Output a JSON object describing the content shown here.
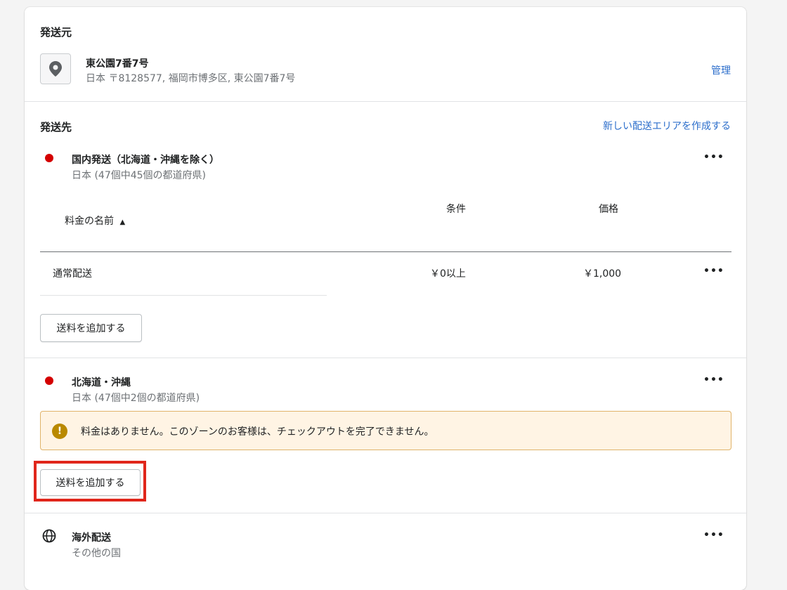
{
  "origin": {
    "title": "発送元",
    "name": "東公園7番7号",
    "address": "日本 〒8128577, 福岡市博多区, 東公園7番7号",
    "manage_link": "管理"
  },
  "destination": {
    "title": "発送先",
    "create_link": "新しい配送エリアを作成する"
  },
  "zone1": {
    "name": "国内発送（北海道・沖縄を除く）",
    "subtitle": "日本 (47個中45個の都道府県)",
    "table": {
      "col_name": "料金の名前",
      "sort_indicator": "▲",
      "col_condition": "条件",
      "col_price": "価格",
      "rows": [
        {
          "name": "通常配送",
          "condition": "￥0以上",
          "price": "￥1,000"
        }
      ]
    },
    "add_button": "送料を追加する"
  },
  "zone2": {
    "name": "北海道・沖縄",
    "subtitle": "日本 (47個中2個の都道府県)",
    "warning": "料金はありません。このゾーンのお客様は、チェックアウトを完了できません。",
    "add_button": "送料を追加する"
  },
  "zone3": {
    "name": "海外配送",
    "subtitle": "その他の国"
  },
  "more_label": "•••",
  "warning_glyph": "!",
  "colors": {
    "zone_dot": "#d40000",
    "link": "#2c6ecb",
    "warning_bg": "#fff4e4",
    "warning_border": "#e0b36a",
    "highlight": "#e0261b"
  },
  "icons": [
    "location-pin-icon",
    "globe-icon",
    "more-actions-icon",
    "warning-icon",
    "sort-ascending-icon"
  ]
}
